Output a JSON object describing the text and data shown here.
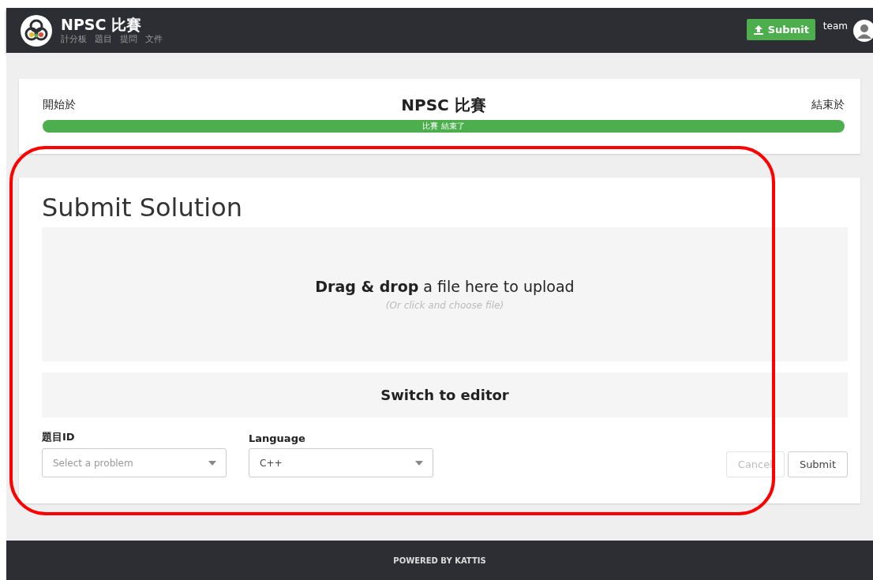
{
  "header": {
    "title": "NPSC 比賽",
    "nav": [
      "計分板",
      "題目",
      "提問",
      "文件"
    ],
    "submit_button": "Submit",
    "user": "team"
  },
  "contest": {
    "start_label": "開始於",
    "title": "NPSC 比賽",
    "end_label": "結束於",
    "progress": {
      "level": 1,
      "label": "比賽 結束了"
    }
  },
  "submit": {
    "heading": "Submit Solution",
    "dropzone": {
      "text": "**Drag & drop** a file here to upload",
      "hint": "(Or click and choose file)"
    },
    "switch_button": "Switch to editor",
    "fields": [
      {
        "label": "題目ID",
        "placeholder": "Select a problem"
      },
      {
        "label": "Language",
        "value": "C++"
      }
    ],
    "buttons": [
      {
        "label": "Cancel",
        "disabled": true
      },
      {
        "label": "Submit",
        "disabled": false
      }
    ]
  },
  "footer": "POWERED BY KATTIS"
}
